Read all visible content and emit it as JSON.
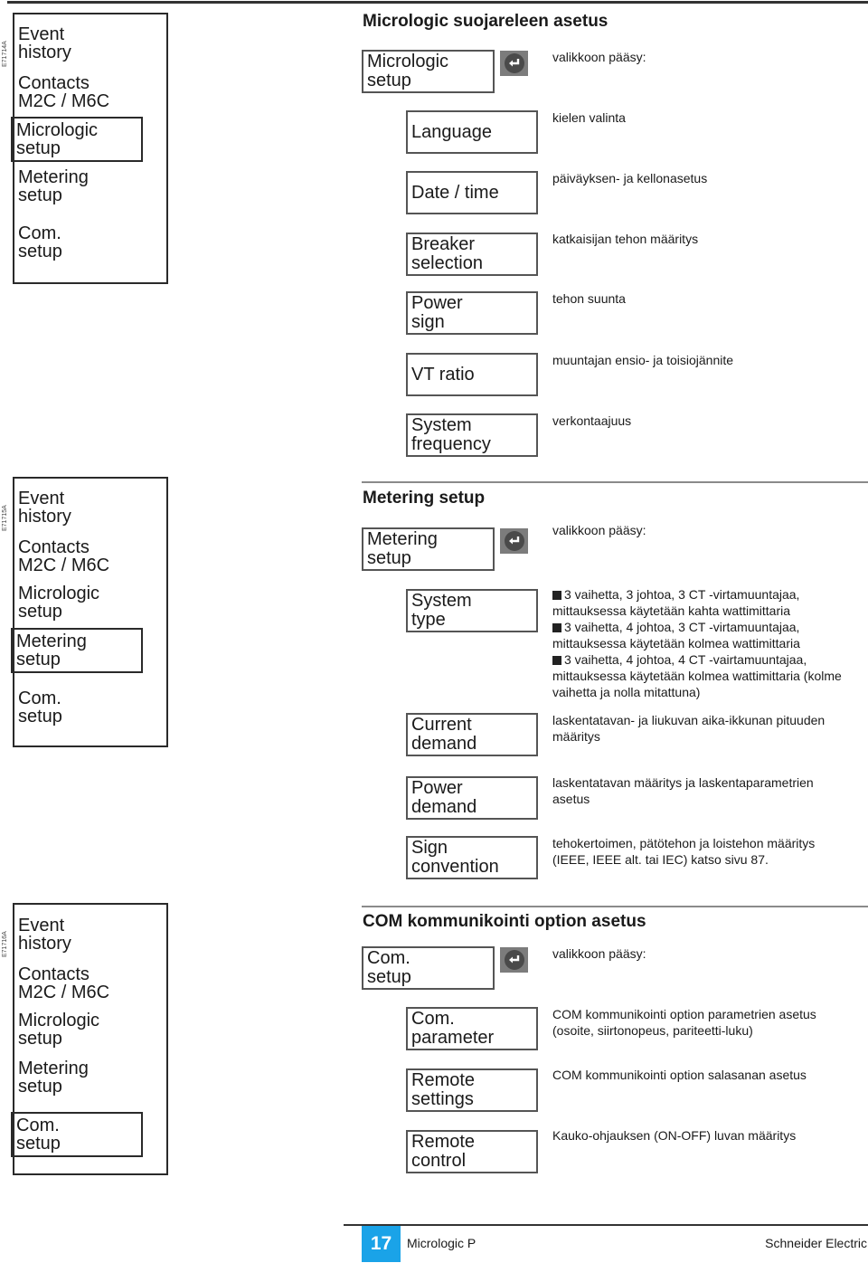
{
  "menu_items": [
    "Event\nhistory",
    "Contacts\nM2C / M6C",
    "Micrologic\nsetup",
    "Metering\nsetup",
    "Com.\nsetup"
  ],
  "sections": [
    {
      "figure_id": "E71714A",
      "selected_menu_index": 2,
      "title": "Micrologic suojareleen asetus",
      "main_box": "Micrologic\nsetup",
      "main_desc": "valikkoon pääsy:",
      "items": [
        {
          "label": "Language",
          "desc": "kielen valinta"
        },
        {
          "label": "Date / time",
          "desc": "päiväyksen- ja kellonasetus"
        },
        {
          "label": "Breaker\nselection",
          "desc": "katkaisijan tehon määritys"
        },
        {
          "label": "Power\nsign",
          "desc": "tehon suunta"
        },
        {
          "label": "VT ratio",
          "desc": "muuntajan ensio- ja toisiojännite"
        },
        {
          "label": "System\nfrequency",
          "desc": "verkontaajuus"
        }
      ]
    },
    {
      "figure_id": "E71715A",
      "selected_menu_index": 3,
      "title": "Metering setup",
      "main_box": "Metering\nsetup",
      "main_desc": "valikkoon pääsy:",
      "items": [
        {
          "label": "System\ntype",
          "bullets": [
            "3 vaihetta, 3 johtoa, 3 CT -virtamuuntajaa, mittauksessa käytetään kahta wattimittaria",
            "3 vaihetta, 4 johtoa, 3 CT -virtamuuntajaa, mittauksessa käytetään kolmea wattimittaria",
            "3 vaihetta, 4 johtoa, 4 CT -vairtamuuntajaa, mittauksessa käytetään kolmea wattimittaria (kolme vaihetta ja nolla mitattuna)"
          ]
        },
        {
          "label": "Current\ndemand",
          "desc": "laskentatavan- ja liukuvan aika-ikkunan pituuden määritys"
        },
        {
          "label": "Power\ndemand",
          "desc": "laskentatavan määritys ja laskentaparametrien asetus"
        },
        {
          "label": "Sign\nconvention",
          "desc": "tehokertoimen, pätötehon ja loistehon määritys (IEEE, IEEE alt. tai IEC) katso sivu 87."
        }
      ]
    },
    {
      "figure_id": "E71716A",
      "selected_menu_index": 4,
      "title": "COM kommunikointi option asetus",
      "main_box": "Com.\nsetup",
      "main_desc": "valikkoon pääsy:",
      "items": [
        {
          "label": "Com.\nparameter",
          "desc": "COM kommunikointi option parametrien asetus (osoite, siirtonopeus, pariteetti-luku)"
        },
        {
          "label": "Remote\nsettings",
          "desc": "COM kommunikointi option salasanan asetus"
        },
        {
          "label": "Remote\ncontrol",
          "desc": "Kauko-ohjauksen (ON-OFF) luvan määritys"
        }
      ]
    }
  ],
  "icons": {
    "enter": "enter-key-icon",
    "bullet": "square-bullet-icon"
  },
  "footer": {
    "page_number": "17",
    "product": "Micrologic P",
    "brand": "Schneider Electric",
    "accent_color": "#1aa3e8"
  }
}
